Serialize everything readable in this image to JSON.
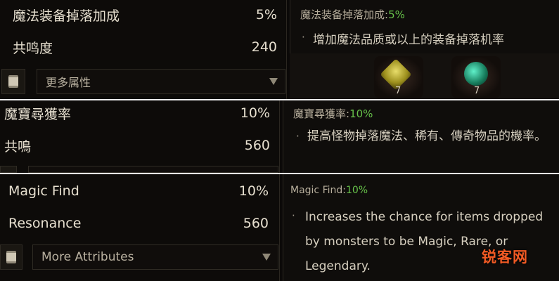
{
  "simplified": {
    "stat_label": "魔法装备掉落加成",
    "stat_value": "5%",
    "resonance_label": "共鸣度",
    "resonance_value": "240",
    "more_attributes": "更多属性",
    "tooltip_key": "魔法装备掉落加成:",
    "tooltip_value": "5%",
    "tooltip_bullet": "·",
    "tooltip_text": "增加魔法品质或以上的装备掉落机率",
    "gem_counts": [
      "7",
      "7"
    ]
  },
  "traditional": {
    "stat_label": "魔寶尋獲率",
    "stat_value": "10%",
    "resonance_label": "共鳴",
    "resonance_value": "560",
    "tooltip_key": "魔寶尋獲率:",
    "tooltip_value": "10%",
    "tooltip_bullet": "·",
    "tooltip_text": "提高怪物掉落魔法、稀有、傳奇物品的機率。"
  },
  "english": {
    "stat_label": "Magic Find",
    "stat_value": "10%",
    "resonance_label": "Resonance",
    "resonance_value": "560",
    "more_attributes": "More Attributes",
    "tooltip_key": "Magic Find:",
    "tooltip_value": "10%",
    "tooltip_bullet": "·",
    "tooltip_text": "Increases the chance for items dropped by monsters to be Magic, Rare, or Legendary."
  },
  "watermark": "锐客网",
  "colors": {
    "value_green": "#67c24a",
    "watermark_orange": "#f15a24"
  }
}
